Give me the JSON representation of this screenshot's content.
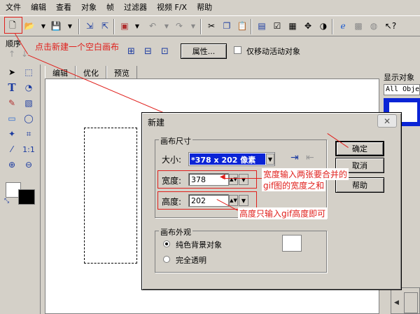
{
  "menu": [
    "文件",
    "编辑",
    "查看",
    "对象",
    "帧",
    "过滤器",
    "视频 F/X",
    "帮助"
  ],
  "toolbar2": {
    "order_label": "顺序",
    "properties_button": "属性...",
    "move_checkbox_label": "仅移动活动对象"
  },
  "doc_tabs": [
    "编辑",
    "优化",
    "预览"
  ],
  "right_panel": {
    "title": "显示对象",
    "dropdown_value": "All Obje"
  },
  "dialog": {
    "title": "新建",
    "canvas_size_group": "画布尺寸",
    "size_label": "大小:",
    "size_value": "*378 x 202 像素",
    "width_label": "宽度:",
    "width_value": "378",
    "height_label": "高度:",
    "height_value": "202",
    "appearance_group": "画布外观",
    "solid_bg_label": "纯色背景对象",
    "transparent_label": "完全透明",
    "ok_button": "确定",
    "cancel_button": "取消",
    "help_button": "帮助"
  },
  "annotations": {
    "new_canvas": "点击新建一个空白画布",
    "width_note_line1": "宽度输入两张要合并的",
    "width_note_line2": "gif图的宽度之和",
    "height_note": "高度只输入gif高度即可"
  },
  "colors": {
    "annotation_red": "#e0201c",
    "selection_blue": "#0a24d6"
  }
}
